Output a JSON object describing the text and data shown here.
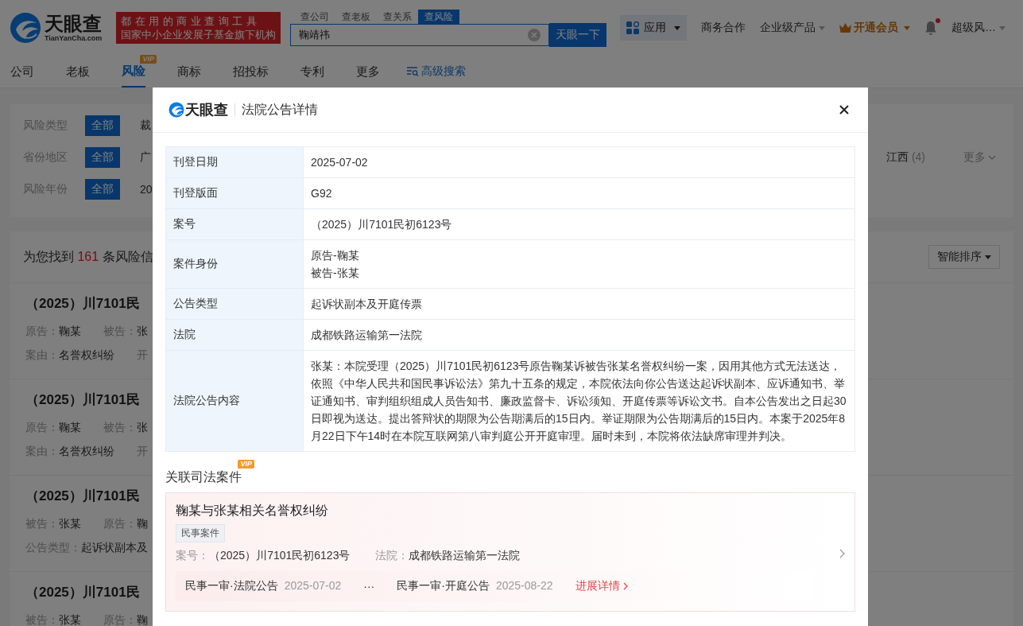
{
  "header": {
    "logo": {
      "name": "天眼查",
      "domain": "TianYanCha.com"
    },
    "slogan": [
      "都在用的商业查询工具",
      "国家中小企业发展子基金旗下机构"
    ],
    "search_tabs": [
      {
        "label": "查公司",
        "selected": false
      },
      {
        "label": "查老板",
        "selected": false
      },
      {
        "label": "查关系",
        "selected": false
      },
      {
        "label": "查风险",
        "selected": true
      }
    ],
    "search": {
      "value": "鞠靖祎",
      "button": "天眼一下"
    },
    "apps_button": "应用",
    "links": [
      {
        "label": "商务合作",
        "dropdown": false
      },
      {
        "label": "企业级产品",
        "dropdown": true
      }
    ],
    "membership": "开通会员",
    "notification": {
      "unread": true
    },
    "user": "超级风…"
  },
  "nav": {
    "items": [
      {
        "label": "公司",
        "selected": false
      },
      {
        "label": "老板",
        "selected": false
      },
      {
        "label": "风险",
        "selected": true,
        "badge": "VIP"
      },
      {
        "label": "商标",
        "selected": false
      },
      {
        "label": "招投标",
        "selected": false
      },
      {
        "label": "专利",
        "selected": false
      },
      {
        "label": "更多",
        "selected": false
      }
    ],
    "advanced_search": "高级搜索"
  },
  "filters": [
    {
      "label": "风险类型",
      "all": "全部",
      "options": [
        {
          "label": "裁"
        }
      ]
    },
    {
      "label": "省份地区",
      "all": "全部",
      "options": [
        {
          "label": "广"
        }
      ],
      "right_options": [
        {
          "label": "江西",
          "count": "(4)"
        }
      ],
      "more": "更多"
    },
    {
      "label": "风险年份",
      "all": "全部",
      "options": [
        {
          "label": "20"
        }
      ]
    }
  ],
  "results": {
    "prefix": "为您找到 ",
    "count": "161",
    "suffix": " 条风险信",
    "sort": "智能排序"
  },
  "cases": [
    {
      "title": "（2025）川7101民",
      "lines": [
        [
          {
            "label": "原告：",
            "value": "鞠某"
          },
          {
            "label": "被告：",
            "value": "张"
          }
        ],
        [
          {
            "label": "案由：",
            "value": "名誉权纠纷"
          },
          {
            "label": "开"
          }
        ]
      ]
    },
    {
      "title": "（2025）川7101民",
      "lines": [
        [
          {
            "label": "原告：",
            "value": "鞠某"
          },
          {
            "label": "被告：",
            "value": "张"
          }
        ],
        [
          {
            "label": "案由：",
            "value": "名誉权纠纷"
          },
          {
            "label": "开"
          }
        ]
      ]
    },
    {
      "title": "（2025）川7101民",
      "lines": [
        [
          {
            "label": "被告：",
            "value": "张某"
          },
          {
            "label": "原告：",
            "value": "鞠"
          }
        ],
        [
          {
            "label": "公告类型：",
            "value": "起诉状副本及"
          }
        ]
      ]
    },
    {
      "title": "（2025）川7101民",
      "lines": [
        [
          {
            "label": "被告：",
            "value": "张某"
          },
          {
            "label": "原告：",
            "value": "鞠"
          }
        ]
      ]
    }
  ],
  "modal": {
    "brand": "天眼查",
    "title": "法院公告详情",
    "rows": [
      {
        "label": "刊登日期",
        "value": [
          "2025-07-02"
        ]
      },
      {
        "label": "刊登版面",
        "value": [
          "G92"
        ]
      },
      {
        "label": "案号",
        "value": [
          "（2025）川7101民初6123号"
        ]
      },
      {
        "label": "案件身份",
        "value": [
          "原告-鞠某",
          "被告-张某"
        ]
      },
      {
        "label": "公告类型",
        "value": [
          "起诉状副本及开庭传票"
        ]
      },
      {
        "label": "法院",
        "value": [
          "成都铁路运输第一法院"
        ]
      },
      {
        "label": "法院公告内容",
        "value": [
          "张某：本院受理（2025）川7101民初6123号原告鞠某诉被告张某名誉权纠纷一案，因用其他方式无法送达，依照《中华人民共和国民事诉讼法》第九十五条的规定，本院依法向你公告送达起诉状副本、应诉通知书、举证通知书、审判组织组成人员告知书、廉政监督卡、诉讼须知、开庭传票等诉讼文书。自本公告发出之日起30日即视为送达。提出答辩状的期限为公告期满后的15日内。举证期限为公告期满后的15日内。本案于2025年8月22日下午14时在本院互联网第八审判庭公开开庭审理。届时未到，本院将依法缺席审理并判决。"
        ]
      }
    ],
    "related": {
      "title": "关联司法案件",
      "badge": "VIP",
      "cases": [
        {
          "title": "鞠某与张某相关名誉权纠纷",
          "tag": "民事案件",
          "case_no_label": "案号：",
          "case_no": "（2025）川7101民初6123号",
          "court_label": "法院：",
          "court": "成都铁路运输第一法院",
          "progress": [
            {
              "stage": "民事一审·法院公告",
              "date": "2025-07-02"
            },
            {
              "stage": "民事一审·开庭公告",
              "date": "2025-08-22"
            }
          ],
          "ellipsis": "···",
          "detail_link": "进展详情"
        }
      ]
    }
  }
}
